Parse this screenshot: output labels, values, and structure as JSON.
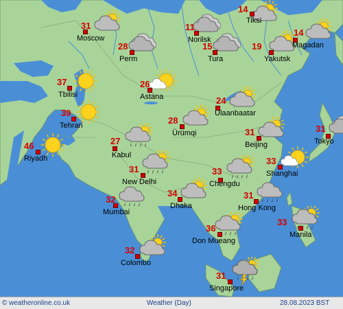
{
  "footer": {
    "source": "© weatheronline.co.uk",
    "title": "Weather (Day)",
    "date": "28.08.2023 BST"
  },
  "cities": [
    {
      "name": "Moscow",
      "temp": "31",
      "icon": "cloudy-sunny-icon"
    },
    {
      "name": "Perm",
      "temp": "28",
      "icon": "cloudy-icon"
    },
    {
      "name": "Norilsk",
      "temp": "11",
      "icon": "cloudy-icon"
    },
    {
      "name": "Tura",
      "temp": "15",
      "icon": "cloudy-icon"
    },
    {
      "name": "Tiksi",
      "temp": "14",
      "icon": "cloudy-sunny-icon"
    },
    {
      "name": "Yakutsk",
      "temp": "19",
      "icon": "cloudy-sunny-icon"
    },
    {
      "name": "Magadan",
      "temp": "14",
      "icon": "cloudy-sunny-icon"
    },
    {
      "name": "Astana",
      "temp": "26",
      "icon": "sun-cloud-icon"
    },
    {
      "name": "Tbilisi",
      "temp": "37",
      "icon": "sunny-icon"
    },
    {
      "name": "Tehran",
      "temp": "39",
      "icon": "sunny-icon"
    },
    {
      "name": "Riyadh",
      "temp": "46",
      "icon": "sunny-icon"
    },
    {
      "name": "Kabul",
      "temp": "27",
      "icon": "rain-sunny-icon"
    },
    {
      "name": "Ürümqi",
      "temp": "28",
      "icon": "cloudy-sunny-icon"
    },
    {
      "name": "Ulaanbaatar",
      "temp": "24",
      "icon": "cloudy-sunny-icon"
    },
    {
      "name": "Beijing",
      "temp": "31",
      "icon": "cloudy-sunny-icon"
    },
    {
      "name": "Shanghai",
      "temp": "33",
      "icon": "sun-cloud-icon"
    },
    {
      "name": "Tokyo",
      "temp": "31",
      "icon": "cloudy-icon"
    },
    {
      "name": "New Delhi",
      "temp": "31",
      "icon": "rain-sunny-icon"
    },
    {
      "name": "Chengdu",
      "temp": "33",
      "icon": "rain-sunny-icon"
    },
    {
      "name": "Mumbai",
      "temp": "32",
      "icon": "rain-icon"
    },
    {
      "name": "Dhaka",
      "temp": "34",
      "icon": "cloudy-sunny-icon"
    },
    {
      "name": "Hong Kong",
      "temp": "31",
      "icon": "rain-icon"
    },
    {
      "name": "Manila",
      "temp": "33",
      "icon": "rain-sunny-icon"
    },
    {
      "name": "Don Mueang",
      "temp": "36",
      "icon": "rain-sunny-icon"
    },
    {
      "name": "Colombo",
      "temp": "32",
      "icon": "cloudy-sunny-icon"
    },
    {
      "name": "Singapore",
      "temp": "31",
      "icon": "thunderstorm-icon"
    }
  ]
}
